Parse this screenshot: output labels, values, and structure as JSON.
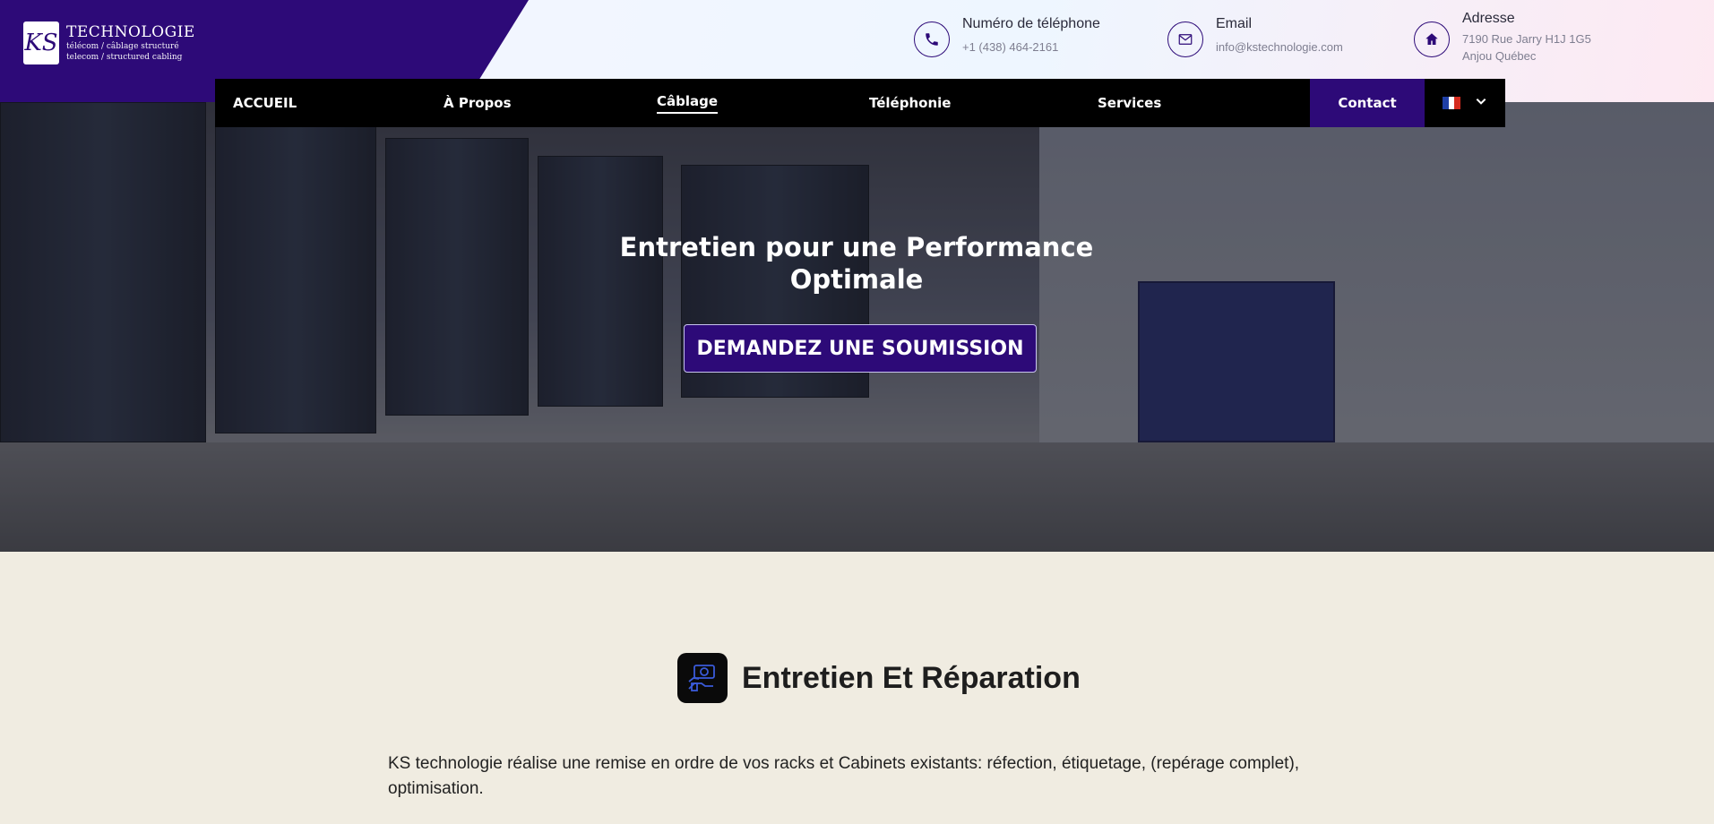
{
  "header": {
    "logo": {
      "mark": "KS",
      "title": "TECHNOLOGIE",
      "subtitle_line1": "télécom / câblage structuré",
      "subtitle_line2": "telecom / structured cabling"
    },
    "contacts": [
      {
        "label": "Numéro de téléphone",
        "value": "+1 (438) 464-2161",
        "icon": "phone-icon"
      },
      {
        "label": "Email",
        "value": "info@kstechnologie.com",
        "icon": "mail-icon"
      },
      {
        "label": "Adresse",
        "value_line1": "7190 Rue Jarry H1J 1G5",
        "value_line2": "Anjou Québec",
        "icon": "home-icon"
      }
    ]
  },
  "nav": {
    "items": [
      {
        "label": "ACCUEIL"
      },
      {
        "label": "À Propos"
      },
      {
        "label": "Câblage",
        "active": true
      },
      {
        "label": "Téléphonie"
      },
      {
        "label": "Services"
      }
    ],
    "contact_label": "Contact",
    "language": "fr"
  },
  "hero": {
    "title_line1": "Entretien pour une Performance",
    "title_line2": "Optimale",
    "cta_label": "DEMANDEZ UNE SOUMISSION"
  },
  "content": {
    "section_icon": "maintenance-icon",
    "section_title": "Entretien Et Réparation",
    "paragraph": "KS technologie réalise une remise en ordre de vos racks et Cabinets existants: réfection, étiquetage, (repérage complet), optimisation."
  },
  "colors": {
    "brand": "#2d0a78",
    "nav_bg": "#000000",
    "page_bg": "#f0ece1"
  }
}
